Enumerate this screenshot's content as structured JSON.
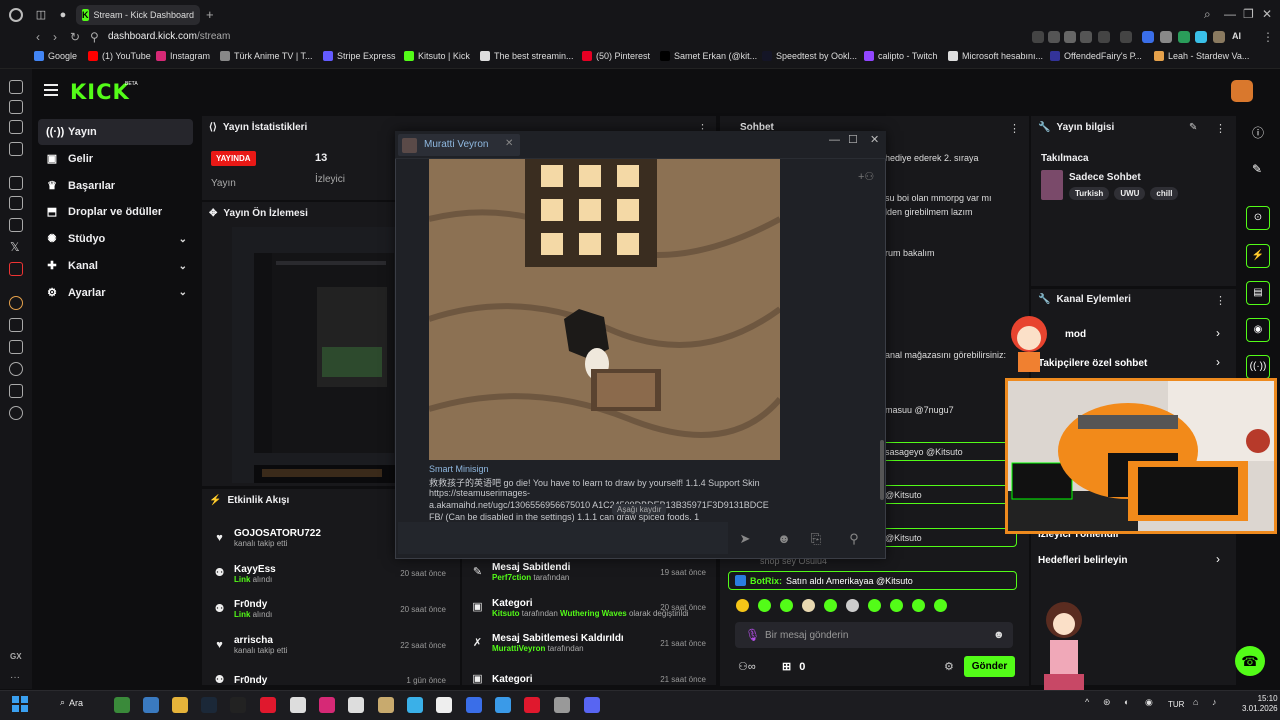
{
  "browser": {
    "active_tab_title": "Stream - Kick Dashboard",
    "url_host": "dashboard.kick.com",
    "url_path": "/stream",
    "bookmarks": [
      {
        "label": "Google",
        "color": "#4285f4"
      },
      {
        "label": "(1) YouTube",
        "color": "#ff0000"
      },
      {
        "label": "Instagram",
        "color": "#d62976"
      },
      {
        "label": "Türk Anime TV | T...",
        "color": "#888888"
      },
      {
        "label": "Stripe Express",
        "color": "#635bff"
      },
      {
        "label": "Kitsuto | Kick",
        "color": "#53fc18"
      },
      {
        "label": "The best streamin...",
        "color": "#dddddd"
      },
      {
        "label": "(50) Pinterest",
        "color": "#e60023"
      },
      {
        "label": "Samet Erkan (@kit...",
        "color": "#000000"
      },
      {
        "label": "Speedtest by Ookl...",
        "color": "#141526"
      },
      {
        "label": "calipto - Twitch",
        "color": "#9146ff"
      },
      {
        "label": "Microsoft hesabını...",
        "color": "#dddddd"
      },
      {
        "label": "OffendedFairy's P...",
        "color": "#333399"
      },
      {
        "label": "Leah - Stardew Va...",
        "color": "#e5a14b"
      }
    ],
    "ai_label": "AI"
  },
  "kick": {
    "logo": "KICK",
    "beta": "BETA",
    "brand_color": "#53fc18"
  },
  "leftnav": [
    {
      "label": "Yayın",
      "icon": "broadcast-icon",
      "active": true
    },
    {
      "label": "Gelir",
      "icon": "revenue-icon"
    },
    {
      "label": "Başarılar",
      "icon": "trophy-icon"
    },
    {
      "label": "Droplar ve ödüller",
      "icon": "gift-icon"
    },
    {
      "label": "Stüdyo",
      "icon": "studio-icon",
      "expandable": true
    },
    {
      "label": "Kanal",
      "icon": "channel-icon",
      "expandable": true
    },
    {
      "label": "Ayarlar",
      "icon": "settings-icon",
      "expandable": true
    }
  ],
  "stats": {
    "title": "Yayın İstatistikleri",
    "live_badge": "YAYINDA",
    "live_label": "Yayın",
    "viewers_value": "13",
    "viewers_label": "İzleyici"
  },
  "preview": {
    "title": "Yayın Ön İzlemesi"
  },
  "activity": {
    "title": "Etkinlik Akışı",
    "events": [
      {
        "name": "GOJOSATORU722",
        "sub": "kanalı takip etti",
        "time": "",
        "icon": "heart-icon"
      },
      {
        "name": "KayyEss",
        "sub_bold": "Link",
        "sub": " alındı",
        "time": "20 saat önce",
        "icon": "reward-icon"
      },
      {
        "name": "Fr0ndy",
        "sub_bold": "Link",
        "sub": " alındı",
        "time": "20 saat önce",
        "icon": "reward-icon"
      },
      {
        "name": "arrischa",
        "sub": "kanalı takip etti",
        "time": "22 saat önce",
        "icon": "heart-icon"
      },
      {
        "name": "Fr0ndy",
        "sub": "",
        "time": "1 gün önce",
        "icon": "reward-icon"
      }
    ]
  },
  "events2": [
    {
      "name": "Mesaj Sabitlendi",
      "sub_bold": "Perf7ction",
      "sub": " tarafından",
      "time": "19 saat önce",
      "icon": "pin-icon"
    },
    {
      "name": "Kategori",
      "sub_bold": "Kitsuto",
      "sub": " tarafından ",
      "sub_bold2": "Wuthering Waves",
      "sub2": " olarak değiştirildi",
      "time": "20 saat önce",
      "icon": "category-icon"
    },
    {
      "name": "Mesaj Sabitlemesi Kaldırıldı",
      "sub_bold": "MurattiVeyron",
      "sub": " tarafından",
      "time": "21 saat önce",
      "icon": "unpin-icon"
    },
    {
      "name": "Kategori",
      "sub": "",
      "time": "21 saat önce",
      "icon": "category-icon"
    }
  ],
  "chat": {
    "title": "Sohbet",
    "lines": [
      "hediye ederek 2. sıraya",
      "su boi olan mmorpg var mı",
      "lden girebilmem lazım",
      "rum bakalım",
      "anal mağazasını görebilirsiniz:",
      "masuu @7nugu7",
      "sasageyo @Kitsuto",
      "@Kitsuto",
      "@Kitsuto",
      "shop sey Osulu4"
    ],
    "botrix_name": "BotRix:",
    "botrix_text": "Satın aldı Amerikayaa @Kitsuto",
    "input_placeholder": "Bir mesaj gönderin",
    "send_label": "Gönder",
    "viewer_count": "0",
    "emote_colors": [
      "#f5c518",
      "#53fc18",
      "#53fc18",
      "#e8d8b0",
      "#53fc18",
      "#cccccc",
      "#53fc18",
      "#53fc18",
      "#53fc18",
      "#53fc18"
    ]
  },
  "info": {
    "title": "Yayın bilgisi",
    "stream_title": "Takılmaca",
    "category": "Sadece Sohbet",
    "tags": [
      "Turkish",
      "UWU",
      "chill"
    ]
  },
  "actions": {
    "title": "Kanal Eylemleri",
    "items": [
      "mod",
      "Takipçilere özel sohbet",
      "İzleyici Yönlendir",
      "Hedefleri belirleyin"
    ]
  },
  "steam": {
    "contact_name": "Muratti Veyron",
    "sign_title": "Smart Minisign",
    "msg_lines": [
      "救救孩子的英语吧 go die!   You have to learn to draw by yourself!   1.1.4 Support Skin",
      "https://steamuserimages-",
      "a.akamaihd.net/ugc/1306556956675010            A1C24509DBDEB13B35971F3D9131BDCE",
      "FB/ (Can be disabled in the settings) 1.1.1              can draw spiced foods. 1"
    ],
    "scroll_label": "Aşağı kaydır"
  },
  "taskbar": {
    "search_label": "Ara",
    "lang": "TUR",
    "time": "15:10",
    "date": "3.01.2026"
  }
}
